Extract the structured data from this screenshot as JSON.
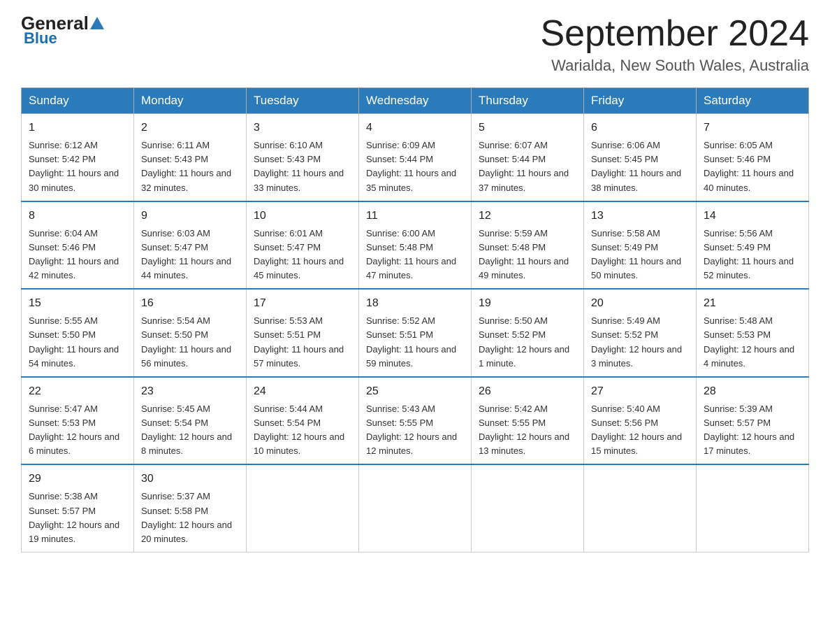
{
  "header": {
    "logo_general": "General",
    "logo_blue": "Blue",
    "month": "September 2024",
    "location": "Warialda, New South Wales, Australia"
  },
  "weekdays": [
    "Sunday",
    "Monday",
    "Tuesday",
    "Wednesday",
    "Thursday",
    "Friday",
    "Saturday"
  ],
  "weeks": [
    [
      {
        "day": "1",
        "sunrise": "6:12 AM",
        "sunset": "5:42 PM",
        "daylight": "11 hours and 30 minutes."
      },
      {
        "day": "2",
        "sunrise": "6:11 AM",
        "sunset": "5:43 PM",
        "daylight": "11 hours and 32 minutes."
      },
      {
        "day": "3",
        "sunrise": "6:10 AM",
        "sunset": "5:43 PM",
        "daylight": "11 hours and 33 minutes."
      },
      {
        "day": "4",
        "sunrise": "6:09 AM",
        "sunset": "5:44 PM",
        "daylight": "11 hours and 35 minutes."
      },
      {
        "day": "5",
        "sunrise": "6:07 AM",
        "sunset": "5:44 PM",
        "daylight": "11 hours and 37 minutes."
      },
      {
        "day": "6",
        "sunrise": "6:06 AM",
        "sunset": "5:45 PM",
        "daylight": "11 hours and 38 minutes."
      },
      {
        "day": "7",
        "sunrise": "6:05 AM",
        "sunset": "5:46 PM",
        "daylight": "11 hours and 40 minutes."
      }
    ],
    [
      {
        "day": "8",
        "sunrise": "6:04 AM",
        "sunset": "5:46 PM",
        "daylight": "11 hours and 42 minutes."
      },
      {
        "day": "9",
        "sunrise": "6:03 AM",
        "sunset": "5:47 PM",
        "daylight": "11 hours and 44 minutes."
      },
      {
        "day": "10",
        "sunrise": "6:01 AM",
        "sunset": "5:47 PM",
        "daylight": "11 hours and 45 minutes."
      },
      {
        "day": "11",
        "sunrise": "6:00 AM",
        "sunset": "5:48 PM",
        "daylight": "11 hours and 47 minutes."
      },
      {
        "day": "12",
        "sunrise": "5:59 AM",
        "sunset": "5:48 PM",
        "daylight": "11 hours and 49 minutes."
      },
      {
        "day": "13",
        "sunrise": "5:58 AM",
        "sunset": "5:49 PM",
        "daylight": "11 hours and 50 minutes."
      },
      {
        "day": "14",
        "sunrise": "5:56 AM",
        "sunset": "5:49 PM",
        "daylight": "11 hours and 52 minutes."
      }
    ],
    [
      {
        "day": "15",
        "sunrise": "5:55 AM",
        "sunset": "5:50 PM",
        "daylight": "11 hours and 54 minutes."
      },
      {
        "day": "16",
        "sunrise": "5:54 AM",
        "sunset": "5:50 PM",
        "daylight": "11 hours and 56 minutes."
      },
      {
        "day": "17",
        "sunrise": "5:53 AM",
        "sunset": "5:51 PM",
        "daylight": "11 hours and 57 minutes."
      },
      {
        "day": "18",
        "sunrise": "5:52 AM",
        "sunset": "5:51 PM",
        "daylight": "11 hours and 59 minutes."
      },
      {
        "day": "19",
        "sunrise": "5:50 AM",
        "sunset": "5:52 PM",
        "daylight": "12 hours and 1 minute."
      },
      {
        "day": "20",
        "sunrise": "5:49 AM",
        "sunset": "5:52 PM",
        "daylight": "12 hours and 3 minutes."
      },
      {
        "day": "21",
        "sunrise": "5:48 AM",
        "sunset": "5:53 PM",
        "daylight": "12 hours and 4 minutes."
      }
    ],
    [
      {
        "day": "22",
        "sunrise": "5:47 AM",
        "sunset": "5:53 PM",
        "daylight": "12 hours and 6 minutes."
      },
      {
        "day": "23",
        "sunrise": "5:45 AM",
        "sunset": "5:54 PM",
        "daylight": "12 hours and 8 minutes."
      },
      {
        "day": "24",
        "sunrise": "5:44 AM",
        "sunset": "5:54 PM",
        "daylight": "12 hours and 10 minutes."
      },
      {
        "day": "25",
        "sunrise": "5:43 AM",
        "sunset": "5:55 PM",
        "daylight": "12 hours and 12 minutes."
      },
      {
        "day": "26",
        "sunrise": "5:42 AM",
        "sunset": "5:55 PM",
        "daylight": "12 hours and 13 minutes."
      },
      {
        "day": "27",
        "sunrise": "5:40 AM",
        "sunset": "5:56 PM",
        "daylight": "12 hours and 15 minutes."
      },
      {
        "day": "28",
        "sunrise": "5:39 AM",
        "sunset": "5:57 PM",
        "daylight": "12 hours and 17 minutes."
      }
    ],
    [
      {
        "day": "29",
        "sunrise": "5:38 AM",
        "sunset": "5:57 PM",
        "daylight": "12 hours and 19 minutes."
      },
      {
        "day": "30",
        "sunrise": "5:37 AM",
        "sunset": "5:58 PM",
        "daylight": "12 hours and 20 minutes."
      },
      null,
      null,
      null,
      null,
      null
    ]
  ]
}
